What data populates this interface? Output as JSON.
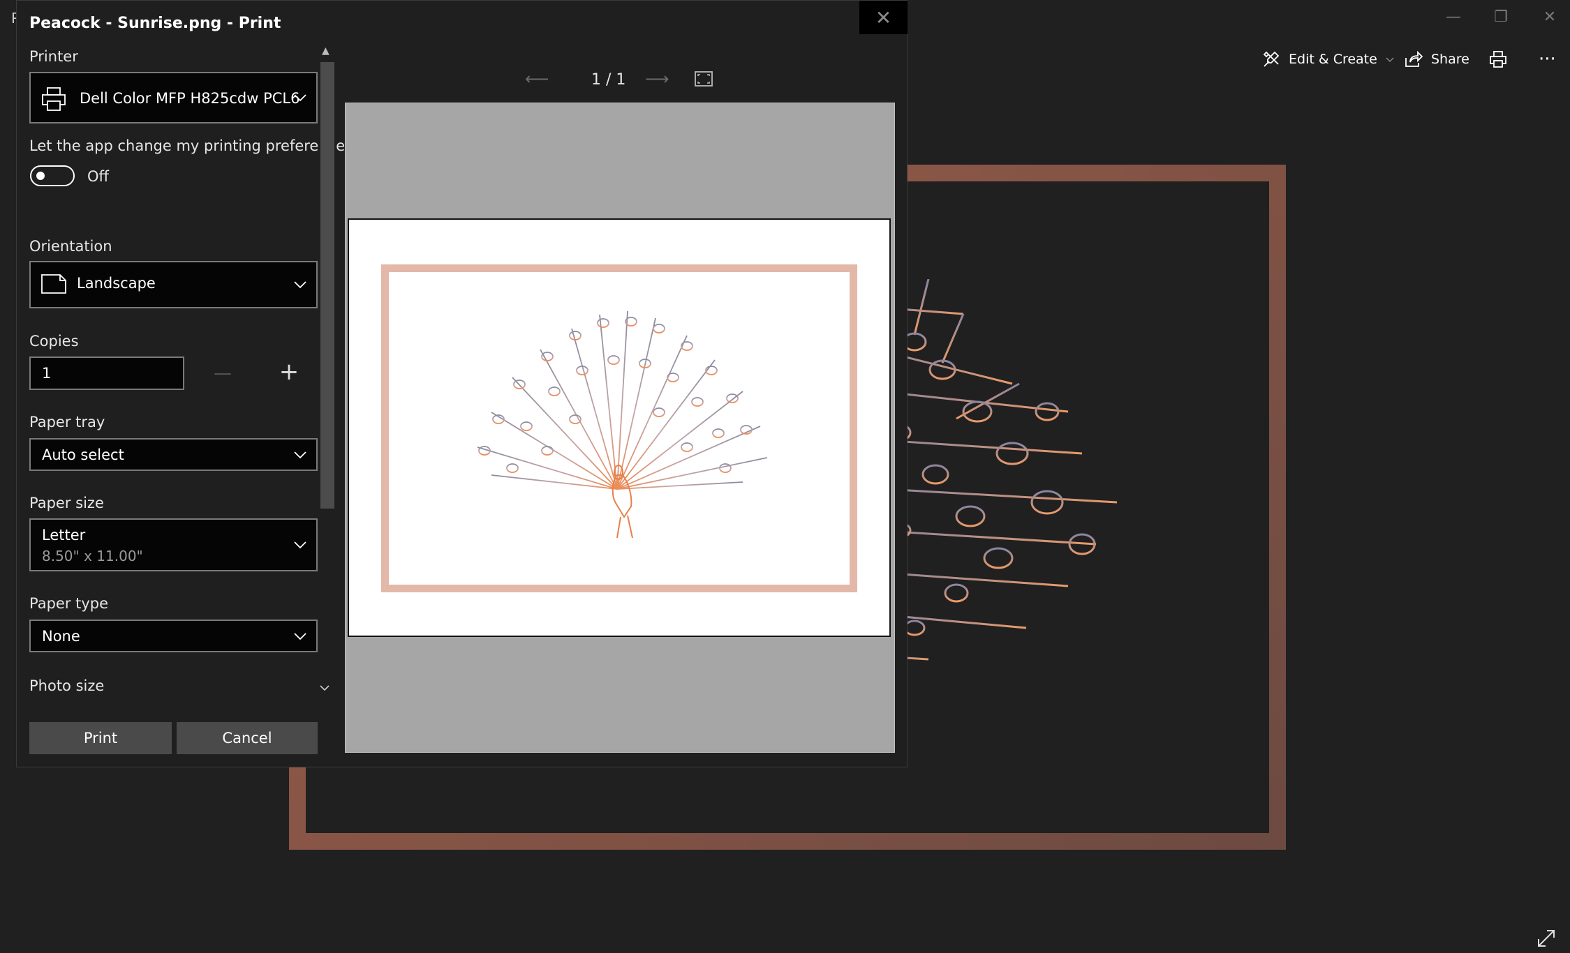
{
  "app": {
    "title_glyph": "P",
    "toolbar": {
      "edit_create": "Edit & Create",
      "share": "Share"
    },
    "window_controls": {
      "minimize": "—",
      "restore": "❐",
      "close": "✕"
    },
    "more": "···"
  },
  "dialog": {
    "title": "Peacock - Sunrise.png - Print",
    "close": "✕",
    "printer": {
      "label": "Printer",
      "value": "Dell Color MFP H825cdw PCL6"
    },
    "prefs": {
      "label": "Let the app change my printing preferences",
      "toggle_state": "Off",
      "enabled": false
    },
    "orientation": {
      "label": "Orientation",
      "value": "Landscape"
    },
    "copies": {
      "label": "Copies",
      "value": "1",
      "decrement": "—",
      "increment": "+"
    },
    "paper_tray": {
      "label": "Paper tray",
      "value": "Auto select"
    },
    "paper_size": {
      "label": "Paper size",
      "value": "Letter",
      "detail": "8.50\" x 11.00\""
    },
    "paper_type": {
      "label": "Paper type",
      "value": "None"
    },
    "photo_size": {
      "label": "Photo size"
    },
    "buttons": {
      "print": "Print",
      "cancel": "Cancel"
    },
    "preview": {
      "page_current": "1",
      "page_total": "1",
      "separator": "/"
    }
  },
  "colors": {
    "background": "#202020",
    "dialog": "#1f1f1f",
    "frame_bg": "#7a4c3d",
    "frame_preview": "#e3b8a8",
    "peacock_top": "#8a8aa0",
    "peacock_bottom": "#e88a5a"
  }
}
